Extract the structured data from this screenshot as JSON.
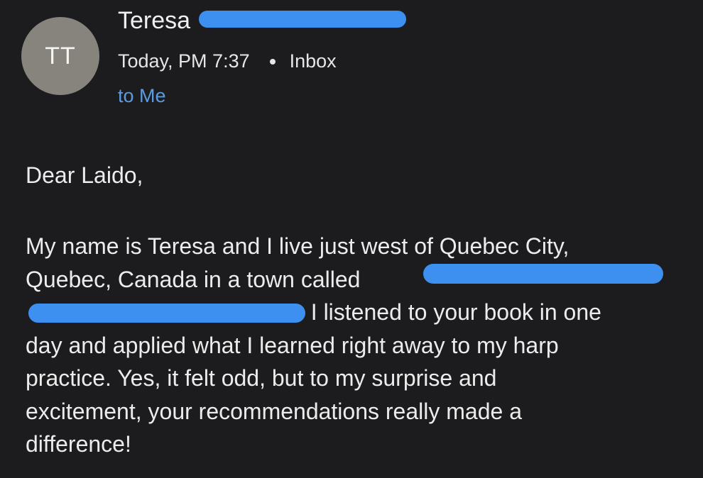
{
  "header": {
    "avatar_initials": "TT",
    "sender_name": "Teresa",
    "date": "Today, PM 7:37",
    "folder": "Inbox",
    "recipient": "to Me"
  },
  "message": {
    "salutation": "Dear Laido,",
    "lines": [
      "My name is Teresa and I live just west of Quebec City,",
      "Quebec, Canada in a town called",
      ". I listened to your book in one",
      "day and applied what I learned right away to my harp",
      "practice. Yes, it felt odd, but to my surprise and",
      "excitement, your recommendations really made a",
      "difference!"
    ]
  },
  "colors": {
    "background": "#1c1c1e",
    "avatar": "#86847c",
    "link_blue": "#5c9be0",
    "redaction_blue": "#3d8ff0"
  }
}
